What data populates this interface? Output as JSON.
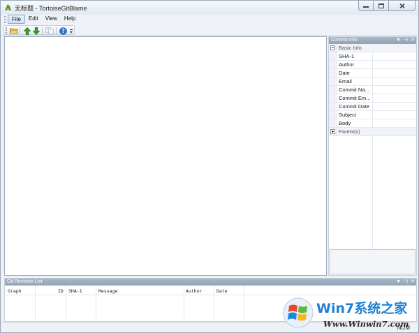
{
  "window": {
    "title": "无标题 - TortoiseGitBlame"
  },
  "menu": {
    "items": [
      {
        "label": "File",
        "active": true
      },
      {
        "label": "Edit",
        "active": false
      },
      {
        "label": "View",
        "active": false
      },
      {
        "label": "Help",
        "active": false
      }
    ]
  },
  "toolbar": {
    "buttons": [
      "open-folder-icon",
      "arrow-up-icon",
      "arrow-down-icon",
      "copy-icon",
      "help-icon",
      "overflow-icon"
    ]
  },
  "commit_info": {
    "title": "Commit Info",
    "basic_info_label": "Basic Info",
    "fields": [
      "SHA-1",
      "Author",
      "Date",
      "Email",
      "Commit Na...",
      "Commit Em...",
      "Commit Date",
      "Subject",
      "Body"
    ],
    "parents_label": "Parent(s)"
  },
  "revision_list": {
    "title": "Git Revision List",
    "columns": [
      "Graph",
      "ID",
      "SHA-1",
      "Message",
      "Author",
      "Date"
    ]
  },
  "statusbar": {
    "text": "NUM"
  },
  "watermark": {
    "brand": "Win7系统之家",
    "url": "Www.Winwin7.com"
  },
  "colors": {
    "accent": "#1f7fd0",
    "panel_header": "#9dadc1",
    "window_bg": "#eef2f7"
  }
}
